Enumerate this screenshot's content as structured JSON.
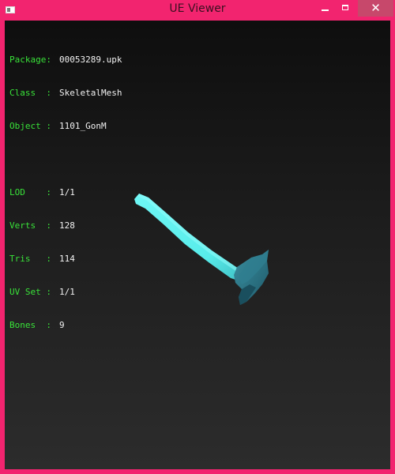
{
  "window": {
    "title": "UE Viewer",
    "close_glyph": "✕",
    "icons": [
      "app-icon",
      "minimize-icon",
      "maximize-icon",
      "close-icon"
    ]
  },
  "info": {
    "package": {
      "key": "Package:",
      "value": "00053289.upk"
    },
    "class": {
      "key": "Class  :",
      "value": "SkeletalMesh"
    },
    "object": {
      "key": "Object :",
      "value": "1101_GonM"
    },
    "lod": {
      "key": "LOD    :",
      "value": "1/1"
    },
    "verts": {
      "key": "Verts  :",
      "value": "128"
    },
    "tris": {
      "key": "Tris   :",
      "value": "114"
    },
    "uvset": {
      "key": "UV Set :",
      "value": "1/1"
    },
    "bones": {
      "key": "Bones  :",
      "value": "9"
    }
  },
  "colors": {
    "window_frame": "#f2246f",
    "label_green": "#39e239",
    "value_white": "#f2f2f2",
    "mesh_handle": "#5ff0ee",
    "mesh_head": "#2a6f80"
  }
}
